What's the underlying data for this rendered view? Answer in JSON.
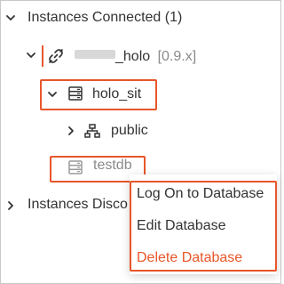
{
  "tree": {
    "connected_header": "Instances Connected (1)",
    "instance_label": "_holo",
    "instance_version": "[0.9.x]",
    "db_holo_sit": "holo_sit",
    "schema_public": "public",
    "db_testdb": "testdb",
    "disconnected_header": "Instances Disco"
  },
  "context_menu": {
    "items": [
      "Log On to Database",
      "Edit Database",
      "Delete Database"
    ]
  },
  "colors": {
    "highlight": "#e8562a",
    "text": "#333333",
    "muted": "#8a8a8a"
  }
}
